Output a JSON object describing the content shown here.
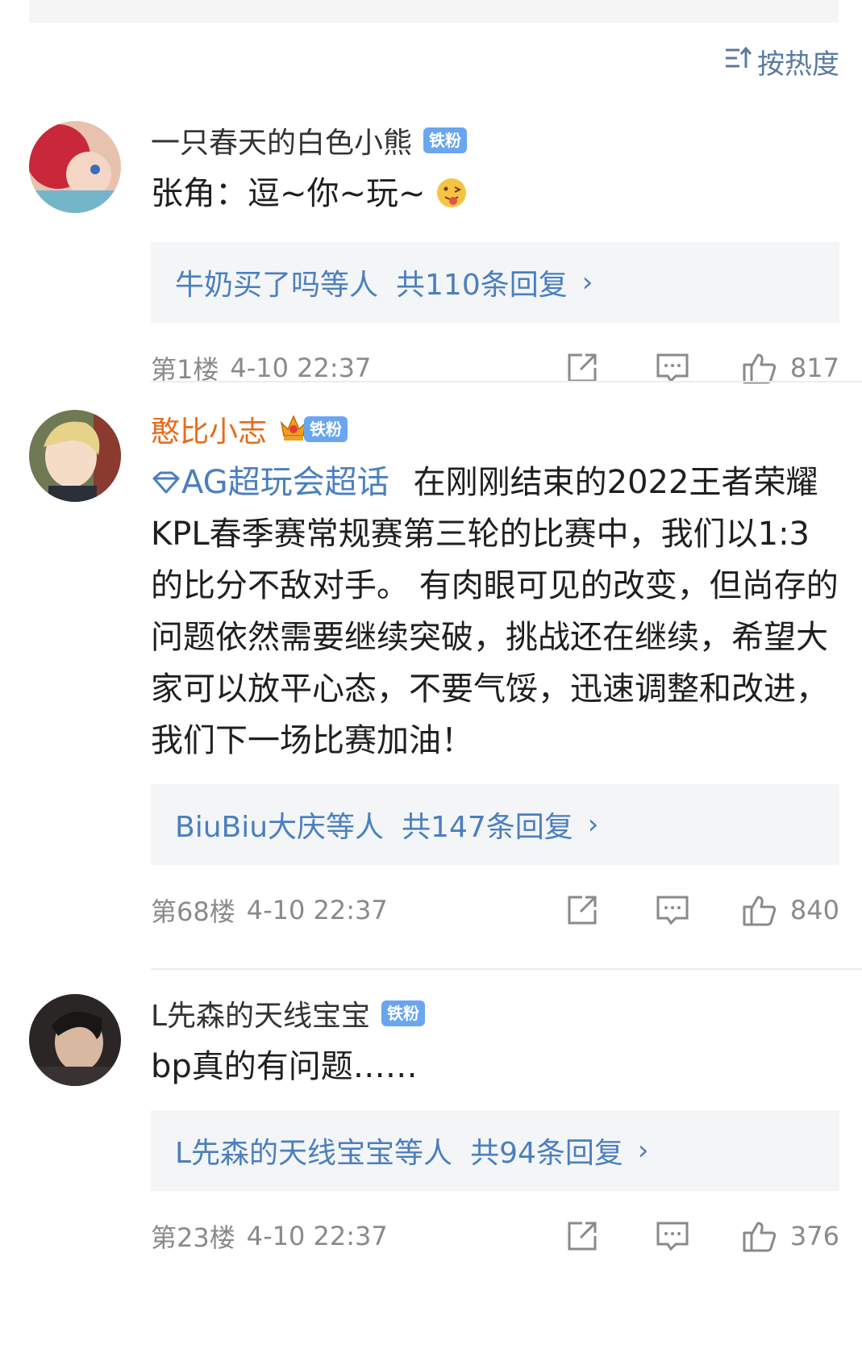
{
  "sort_label": "按热度",
  "comments": [
    {
      "username": "一只春天的白色小熊",
      "badge": "铁粉",
      "text": "张角：逗~你~玩~",
      "reply_prefix": "牛奶买了吗等人",
      "reply_count_text": "共110条回复",
      "floor": "第1楼",
      "time": "4-10 22:37",
      "likes": "817"
    },
    {
      "username": "憨比小志",
      "badge": "铁粉",
      "topic": "AG超玩会超话",
      "text": "在刚刚结束的2022王者荣耀KPL春季赛常规赛第三轮的比赛中，我们以1:3的比分不敌对手。 有肉眼可见的改变，但尚存的问题依然需要继续突破，挑战还在继续，希望大家可以放平心态，不要气馁，迅速调整和改进，我们下一场比赛加油！",
      "reply_prefix": "BiuBiu大庆等人",
      "reply_count_text": "共147条回复",
      "floor": "第68楼",
      "time": "4-10 22:37",
      "likes": "840"
    },
    {
      "username": "L先森的天线宝宝",
      "badge": "铁粉",
      "text": "bp真的有问题……",
      "reply_prefix": "L先森的天线宝宝等人",
      "reply_count_text": "共94条回复",
      "floor": "第23楼",
      "time": "4-10 22:37",
      "likes": "376"
    }
  ],
  "colors": {
    "link": "#4a7fbf",
    "vip_name": "#e86a1a",
    "badge": "#6aa5f0",
    "meta": "#8a8a8a"
  },
  "icons": [
    "sort-icon",
    "share-icon",
    "comment-icon",
    "like-icon",
    "chevron-right-icon",
    "diamond-icon",
    "crown-icon"
  ]
}
